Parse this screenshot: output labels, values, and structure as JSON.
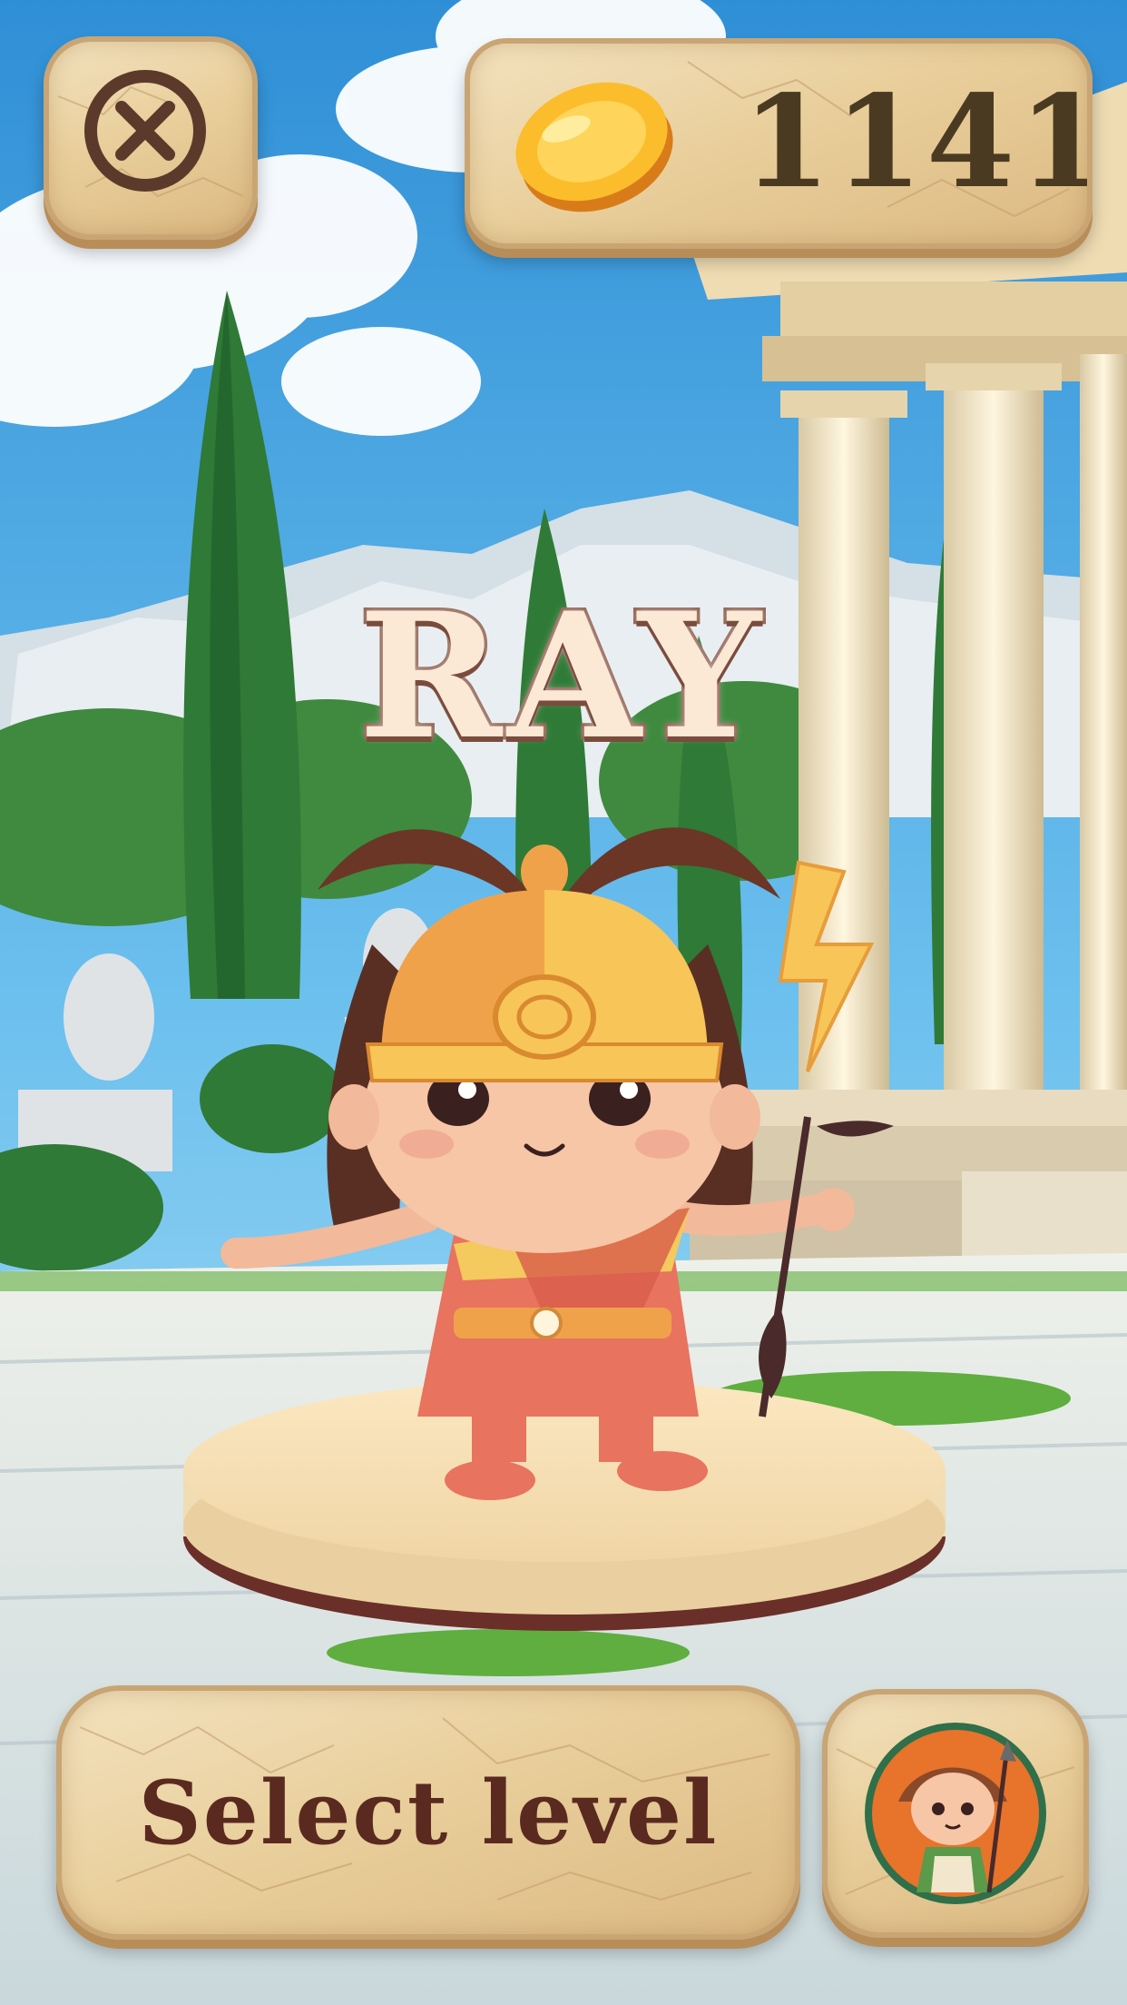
{
  "hud": {
    "close_icon": "close-icon",
    "coin_icon": "gold-coin-icon",
    "coins": "1141"
  },
  "hero": {
    "name": "RAY"
  },
  "footer": {
    "select_level_label": "Select level",
    "character_icon": "hero-avatar-icon"
  },
  "colors": {
    "sky": "#4aa3dc",
    "stone": "#e9cf9c",
    "stone_border": "#c9a574",
    "text_dark": "#4a3a22",
    "label_brown": "#5a2a20",
    "title_fill": "#fbe9d6",
    "title_stroke": "#8d5f4f"
  }
}
